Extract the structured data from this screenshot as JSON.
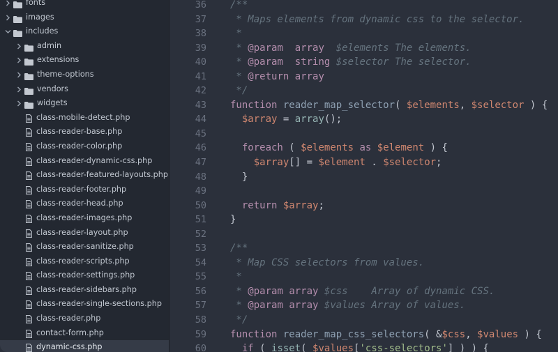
{
  "sidebar": {
    "items": [
      {
        "label": "fonts",
        "type": "folder",
        "depth": 0,
        "expanded": false
      },
      {
        "label": "images",
        "type": "folder",
        "depth": 0,
        "expanded": false
      },
      {
        "label": "includes",
        "type": "folder",
        "depth": 0,
        "expanded": true
      },
      {
        "label": "admin",
        "type": "folder",
        "depth": 1,
        "expanded": false
      },
      {
        "label": "extensions",
        "type": "folder",
        "depth": 1,
        "expanded": false
      },
      {
        "label": "theme-options",
        "type": "folder",
        "depth": 1,
        "expanded": false
      },
      {
        "label": "vendors",
        "type": "folder",
        "depth": 1,
        "expanded": false
      },
      {
        "label": "widgets",
        "type": "folder",
        "depth": 1,
        "expanded": false
      },
      {
        "label": "class-mobile-detect.php",
        "type": "file",
        "depth": 1
      },
      {
        "label": "class-reader-base.php",
        "type": "file",
        "depth": 1
      },
      {
        "label": "class-reader-color.php",
        "type": "file",
        "depth": 1
      },
      {
        "label": "class-reader-dynamic-css.php",
        "type": "file",
        "depth": 1
      },
      {
        "label": "class-reader-featured-layouts.php",
        "type": "file",
        "depth": 1
      },
      {
        "label": "class-reader-footer.php",
        "type": "file",
        "depth": 1
      },
      {
        "label": "class-reader-head.php",
        "type": "file",
        "depth": 1
      },
      {
        "label": "class-reader-images.php",
        "type": "file",
        "depth": 1
      },
      {
        "label": "class-reader-layout.php",
        "type": "file",
        "depth": 1
      },
      {
        "label": "class-reader-sanitize.php",
        "type": "file",
        "depth": 1
      },
      {
        "label": "class-reader-scripts.php",
        "type": "file",
        "depth": 1
      },
      {
        "label": "class-reader-settings.php",
        "type": "file",
        "depth": 1
      },
      {
        "label": "class-reader-sidebars.php",
        "type": "file",
        "depth": 1
      },
      {
        "label": "class-reader-single-sections.php",
        "type": "file",
        "depth": 1
      },
      {
        "label": "class-reader.php",
        "type": "file",
        "depth": 1
      },
      {
        "label": "contact-form.php",
        "type": "file",
        "depth": 1
      },
      {
        "label": "dynamic-css.php",
        "type": "file",
        "depth": 1,
        "selected": true
      }
    ]
  },
  "editor": {
    "lines": [
      {
        "num": "36",
        "tokens": [
          [
            "c",
            "/**"
          ]
        ]
      },
      {
        "num": "37",
        "tokens": [
          [
            "c",
            " * Maps elements from dynamic css to the selector."
          ]
        ]
      },
      {
        "num": "38",
        "tokens": [
          [
            "c",
            " *"
          ]
        ]
      },
      {
        "num": "39",
        "tokens": [
          [
            "c",
            " * "
          ],
          [
            "k",
            "@param"
          ],
          [
            "c",
            "  "
          ],
          [
            "k",
            "array"
          ],
          [
            "c",
            "  $elements The elements."
          ]
        ]
      },
      {
        "num": "40",
        "tokens": [
          [
            "c",
            " * "
          ],
          [
            "k",
            "@param"
          ],
          [
            "c",
            "  "
          ],
          [
            "k",
            "string"
          ],
          [
            "c",
            " $selector The selector."
          ]
        ]
      },
      {
        "num": "41",
        "tokens": [
          [
            "c",
            " * "
          ],
          [
            "k",
            "@return"
          ],
          [
            "c",
            " "
          ],
          [
            "k",
            "array"
          ]
        ]
      },
      {
        "num": "42",
        "tokens": [
          [
            "c",
            " */"
          ]
        ]
      },
      {
        "num": "43",
        "tokens": [
          [
            "k",
            "function"
          ],
          [
            "p",
            " "
          ],
          [
            "f",
            "reader_map_selector"
          ],
          [
            "p",
            "( "
          ],
          [
            "v",
            "$elements"
          ],
          [
            "p",
            ", "
          ],
          [
            "v",
            "$selector"
          ],
          [
            "p",
            " ) {"
          ]
        ]
      },
      {
        "num": "44",
        "tokens": [
          [
            "p",
            "  "
          ],
          [
            "v",
            "$array"
          ],
          [
            "p",
            " = "
          ],
          [
            "bi",
            "array"
          ],
          [
            "p",
            "();"
          ]
        ]
      },
      {
        "num": "45",
        "tokens": []
      },
      {
        "num": "46",
        "tokens": [
          [
            "p",
            "  "
          ],
          [
            "k",
            "foreach"
          ],
          [
            "p",
            " ( "
          ],
          [
            "v",
            "$elements"
          ],
          [
            "p",
            " "
          ],
          [
            "k",
            "as"
          ],
          [
            "p",
            " "
          ],
          [
            "v",
            "$element"
          ],
          [
            "p",
            " ) {"
          ]
        ]
      },
      {
        "num": "47",
        "tokens": [
          [
            "p",
            "    "
          ],
          [
            "v",
            "$array"
          ],
          [
            "p",
            "[] = "
          ],
          [
            "v",
            "$element"
          ],
          [
            "p",
            " . "
          ],
          [
            "v",
            "$selector"
          ],
          [
            "p",
            ";"
          ]
        ]
      },
      {
        "num": "48",
        "tokens": [
          [
            "p",
            "  }"
          ]
        ]
      },
      {
        "num": "49",
        "tokens": []
      },
      {
        "num": "50",
        "tokens": [
          [
            "p",
            "  "
          ],
          [
            "k",
            "return"
          ],
          [
            "p",
            " "
          ],
          [
            "v",
            "$array"
          ],
          [
            "p",
            ";"
          ]
        ]
      },
      {
        "num": "51",
        "tokens": [
          [
            "p",
            "}"
          ]
        ]
      },
      {
        "num": "52",
        "tokens": []
      },
      {
        "num": "53",
        "tokens": [
          [
            "c",
            "/**"
          ]
        ]
      },
      {
        "num": "54",
        "tokens": [
          [
            "c",
            " * Map CSS selectors from values."
          ]
        ]
      },
      {
        "num": "55",
        "tokens": [
          [
            "c",
            " *"
          ]
        ]
      },
      {
        "num": "56",
        "tokens": [
          [
            "c",
            " * "
          ],
          [
            "k",
            "@param"
          ],
          [
            "c",
            " "
          ],
          [
            "k",
            "array"
          ],
          [
            "c",
            " $css    Array of dynamic CSS."
          ]
        ]
      },
      {
        "num": "57",
        "tokens": [
          [
            "c",
            " * "
          ],
          [
            "k",
            "@param"
          ],
          [
            "c",
            " "
          ],
          [
            "k",
            "array"
          ],
          [
            "c",
            " $values Array of values."
          ]
        ]
      },
      {
        "num": "58",
        "tokens": [
          [
            "c",
            " */"
          ]
        ]
      },
      {
        "num": "59",
        "tokens": [
          [
            "k",
            "function"
          ],
          [
            "p",
            " "
          ],
          [
            "f",
            "reader_map_css_selectors"
          ],
          [
            "p",
            "( &"
          ],
          [
            "v",
            "$css"
          ],
          [
            "p",
            ", "
          ],
          [
            "v",
            "$values"
          ],
          [
            "p",
            " ) {"
          ]
        ]
      },
      {
        "num": "60",
        "tokens": [
          [
            "p",
            "  "
          ],
          [
            "k",
            "if"
          ],
          [
            "p",
            " ( "
          ],
          [
            "bi",
            "isset"
          ],
          [
            "p",
            "( "
          ],
          [
            "v",
            "$values"
          ],
          [
            "p",
            "["
          ],
          [
            "s",
            "'css-selectors'"
          ],
          [
            "p",
            "] ) ) {"
          ]
        ]
      }
    ]
  },
  "colors": {
    "sidebar_bg": "#232831",
    "editor_bg": "#2b303b",
    "selected_row": "#353b47",
    "folder_icon": "#c3c8d0",
    "keyword": "#b48ead",
    "function": "#8fa1b3",
    "variable": "#d08770",
    "comment": "#65737e",
    "string": "#a3be8c"
  },
  "icons": {
    "collapsed": "chevron-right-icon",
    "expanded": "chevron-down-icon",
    "folder": "folder-icon",
    "file": "file-icon"
  }
}
